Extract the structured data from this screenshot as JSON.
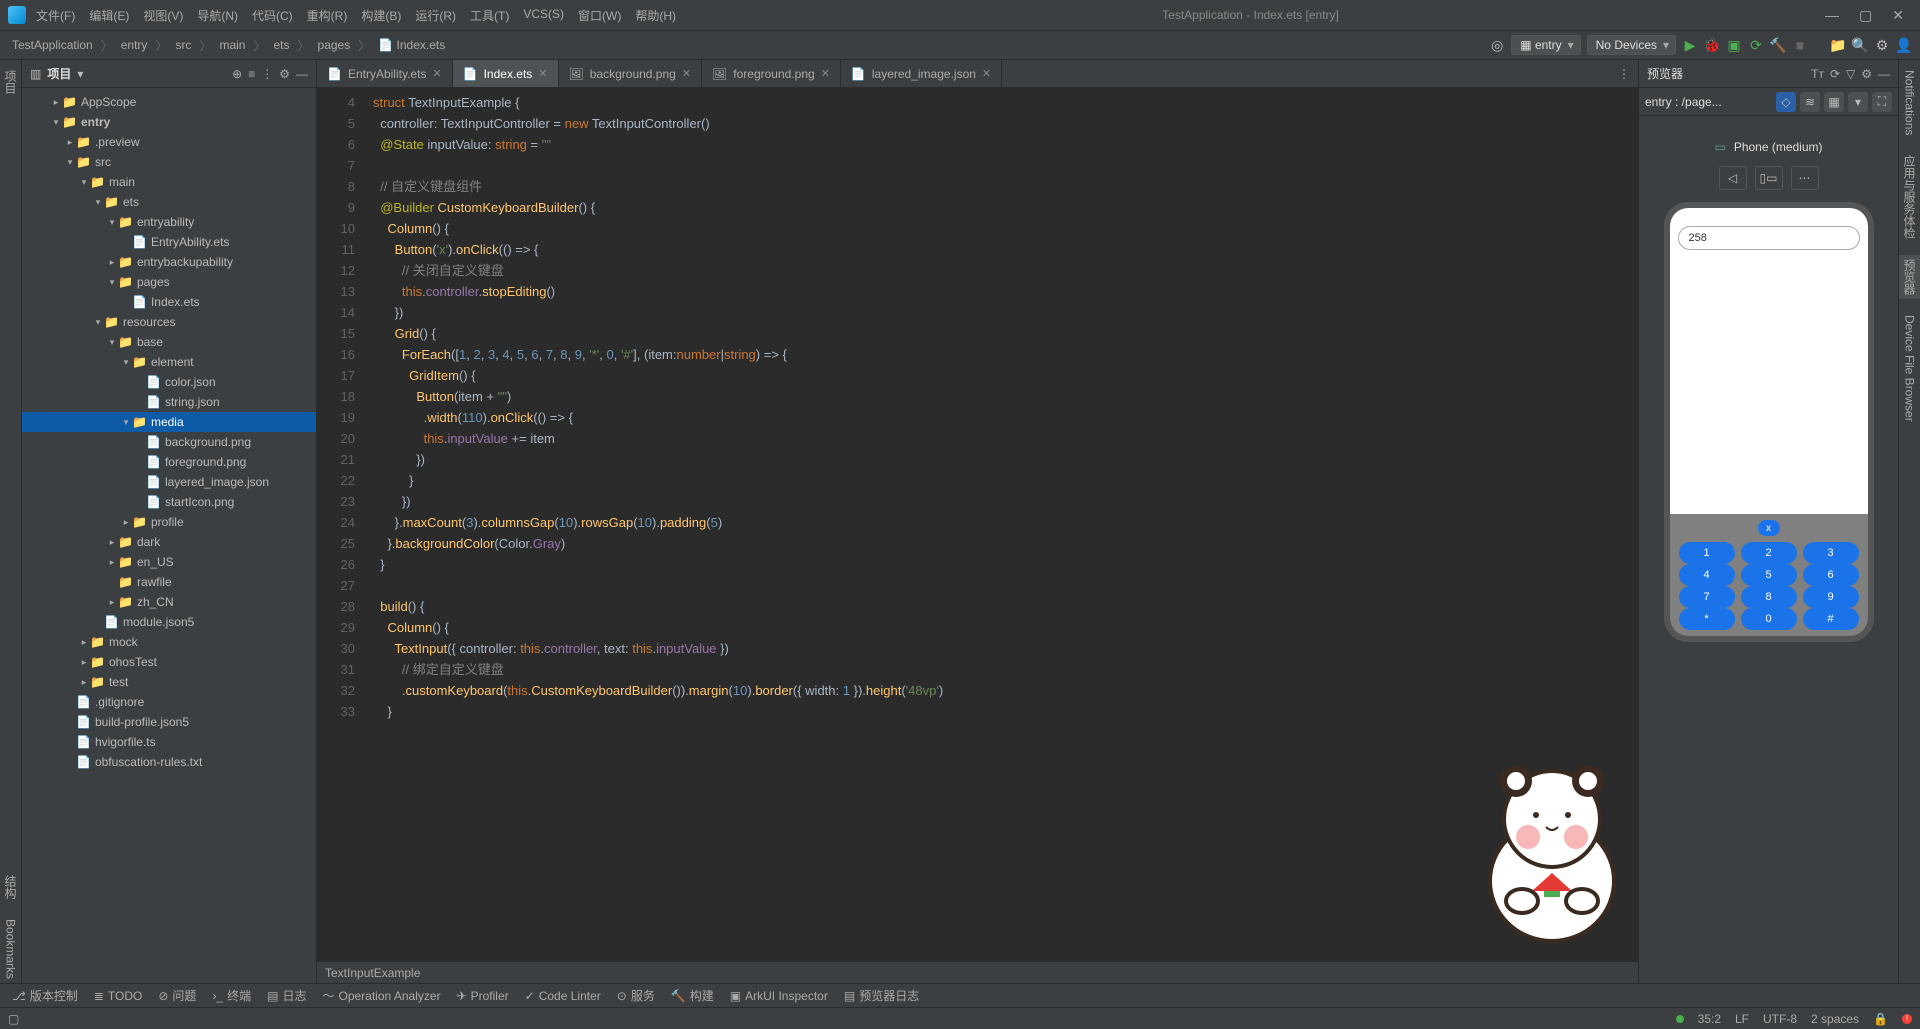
{
  "menu": {
    "file": "文件(F)",
    "edit": "编辑(E)",
    "view": "视图(V)",
    "nav": "导航(N)",
    "code": "代码(C)",
    "refactor": "重构(R)",
    "build": "构建(B)",
    "run": "运行(R)",
    "tools": "工具(T)",
    "vcs": "VCS(S)",
    "window": "窗口(W)",
    "help": "帮助(H)"
  },
  "apptitle": "TestApplication - Index.ets [entry]",
  "breadcrumb": [
    "TestApplication",
    "entry",
    "src",
    "main",
    "ets",
    "pages",
    "Index.ets"
  ],
  "breadcrumb_icon_last": "📄",
  "runconfig": "entry",
  "devices": "No Devices",
  "project": {
    "label": "项目"
  },
  "tree": [
    {
      "d": 2,
      "a": "col",
      "i": "📁",
      "t": "AppScope"
    },
    {
      "d": 2,
      "a": "exp",
      "i": "📁",
      "t": "entry",
      "bold": true
    },
    {
      "d": 3,
      "a": "col",
      "i": "📁",
      "t": ".preview",
      "cls": "fld-o"
    },
    {
      "d": 3,
      "a": "exp",
      "i": "📁",
      "t": "src"
    },
    {
      "d": 4,
      "a": "exp",
      "i": "📁",
      "t": "main"
    },
    {
      "d": 5,
      "a": "exp",
      "i": "📁",
      "t": "ets"
    },
    {
      "d": 6,
      "a": "exp",
      "i": "📁",
      "t": "entryability"
    },
    {
      "d": 7,
      "a": "",
      "i": "📄",
      "t": "EntryAbility.ets"
    },
    {
      "d": 6,
      "a": "col",
      "i": "📁",
      "t": "entrybackupability"
    },
    {
      "d": 6,
      "a": "exp",
      "i": "📁",
      "t": "pages"
    },
    {
      "d": 7,
      "a": "",
      "i": "📄",
      "t": "Index.ets"
    },
    {
      "d": 5,
      "a": "exp",
      "i": "📁",
      "t": "resources"
    },
    {
      "d": 6,
      "a": "exp",
      "i": "📁",
      "t": "base"
    },
    {
      "d": 7,
      "a": "exp",
      "i": "📁",
      "t": "element"
    },
    {
      "d": 8,
      "a": "",
      "i": "📄",
      "t": "color.json"
    },
    {
      "d": 8,
      "a": "",
      "i": "📄",
      "t": "string.json"
    },
    {
      "d": 7,
      "a": "exp",
      "i": "📁",
      "t": "media",
      "sel": true
    },
    {
      "d": 8,
      "a": "",
      "i": "📄",
      "t": "background.png"
    },
    {
      "d": 8,
      "a": "",
      "i": "📄",
      "t": "foreground.png"
    },
    {
      "d": 8,
      "a": "",
      "i": "📄",
      "t": "layered_image.json"
    },
    {
      "d": 8,
      "a": "",
      "i": "📄",
      "t": "startIcon.png"
    },
    {
      "d": 7,
      "a": "col",
      "i": "📁",
      "t": "profile"
    },
    {
      "d": 6,
      "a": "col",
      "i": "📁",
      "t": "dark"
    },
    {
      "d": 6,
      "a": "col",
      "i": "📁",
      "t": "en_US"
    },
    {
      "d": 6,
      "a": "",
      "i": "📁",
      "t": "rawfile"
    },
    {
      "d": 6,
      "a": "col",
      "i": "📁",
      "t": "zh_CN"
    },
    {
      "d": 5,
      "a": "",
      "i": "📄",
      "t": "module.json5"
    },
    {
      "d": 4,
      "a": "col",
      "i": "📁",
      "t": "mock"
    },
    {
      "d": 4,
      "a": "col",
      "i": "📁",
      "t": "ohosTest"
    },
    {
      "d": 4,
      "a": "col",
      "i": "📁",
      "t": "test"
    },
    {
      "d": 3,
      "a": "",
      "i": "📄",
      "t": ".gitignore"
    },
    {
      "d": 3,
      "a": "",
      "i": "📄",
      "t": "build-profile.json5"
    },
    {
      "d": 3,
      "a": "",
      "i": "📄",
      "t": "hvigorfile.ts"
    },
    {
      "d": 3,
      "a": "",
      "i": "📄",
      "t": "obfuscation-rules.txt"
    }
  ],
  "tabs": [
    {
      "label": "EntryAbility.ets",
      "icon": "📄"
    },
    {
      "label": "Index.ets",
      "icon": "📄",
      "active": true
    },
    {
      "label": "background.png",
      "icon": "🖼"
    },
    {
      "label": "foreground.png",
      "icon": "🖼"
    },
    {
      "label": "layered_image.json",
      "icon": "📄"
    }
  ],
  "code_crumb": "TextInputExample",
  "lines": {
    "start": 4,
    "rows": [
      "<span class='kw'>struct</span> <span class='typ'>TextInputExample</span> <span class='brace'>{</span>",
      "  controller: <span class='typ'>TextInputController</span> = <span class='kw'>new</span> <span class='typ'>TextInputController</span>()",
      "  <span class='dec'>@State</span> inputValue: <span class='kw'>string</span> = <span class='str'>\"\"</span>",
      "",
      "  <span class='cmt'>// 自定义键盘组件</span>",
      "  <span class='dec'>@Builder</span> <span class='fn'>CustomKeyboardBuilder</span>() {",
      "    <span class='fn'>Column</span>() {",
      "      <span class='fn'>Button</span>(<span class='str'>'x'</span>).<span class='fn'>onClick</span>(() =&gt; {",
      "        <span class='cmt'>// 关闭自定义键盘</span>",
      "        <span class='kw'>this</span>.<span class='prop'>controller</span>.<span class='fn'>stopEditing</span>()",
      "      })",
      "      <span class='fn'>Grid</span>() {",
      "        <span class='fn'>ForEach</span>([<span class='num'>1</span>, <span class='num'>2</span>, <span class='num'>3</span>, <span class='num'>4</span>, <span class='num'>5</span>, <span class='num'>6</span>, <span class='num'>7</span>, <span class='num'>8</span>, <span class='num'>9</span>, <span class='str'>'*'</span>, <span class='num'>0</span>, <span class='str'>'#'</span>], (<span class='par'>item</span>:<span class='kw'>number</span>|<span class='kw'>string</span>) =&gt; {",
      "          <span class='fn'>GridItem</span>() {",
      "            <span class='fn'>Button</span>(item + <span class='str'>\"\"</span>)",
      "              .<span class='fn'>width</span>(<span class='num'>110</span>).<span class='fn'>onClick</span>(() =&gt; {",
      "              <span class='kw'>this</span>.<span class='prop'>inputValue</span> += item",
      "            })",
      "          }",
      "        })",
      "      }.<span class='fn'>maxCount</span>(<span class='num'>3</span>).<span class='fn'>columnsGap</span>(<span class='num'>10</span>).<span class='fn'>rowsGap</span>(<span class='num'>10</span>).<span class='fn'>padding</span>(<span class='num'>5</span>)",
      "    }.<span class='fn'>backgroundColor</span>(Color.<span class='prop'>Gray</span>)",
      "  }",
      "",
      "  <span class='fn'>build</span>() {",
      "    <span class='fn'>Column</span>() {",
      "      <span class='fn'>TextInput</span>({ controller: <span class='kw'>this</span>.<span class='prop'>controller</span>, text: <span class='kw'>this</span>.<span class='prop'>inputValue</span> })",
      "        <span class='cmt'>// 绑定自定义键盘</span>",
      "        .<span class='fn'>customKeyboard</span>(<span class='kw'>this</span>.<span class='fn'>CustomKeyboardBuilder</span>()).<span class='fn'>margin</span>(<span class='num'>10</span>).<span class='fn'>border</span>({ width: <span class='num'>1</span> }).<span class='fn'>height</span>(<span class='str'>'48vp'</span>)",
      "    }"
    ]
  },
  "preview": {
    "title": "预览器",
    "sub": "entry : /page...",
    "device": "Phone (medium)",
    "input_value": "258",
    "keys": [
      [
        "1",
        "2",
        "3"
      ],
      [
        "4",
        "5",
        "6"
      ],
      [
        "7",
        "8",
        "9"
      ],
      [
        "*",
        "0",
        "#"
      ]
    ],
    "kbd_x": "x"
  },
  "left_gutter": [
    "项目"
  ],
  "left_gutter2": [
    "结构",
    "Bookmarks"
  ],
  "right_gutter": [
    "Notifications",
    "应用与服务体检",
    "预览器",
    "Device File Browser"
  ],
  "bottom": [
    "版本控制",
    "TODO",
    "问题",
    "终端",
    "日志",
    "Operation Analyzer",
    "Profiler",
    "Code Linter",
    "服务",
    "构建",
    "ArkUI Inspector",
    "预览器日志"
  ],
  "status": {
    "pos": "35:2",
    "le": "LF",
    "enc": "UTF-8",
    "indent": "2 spaces"
  }
}
